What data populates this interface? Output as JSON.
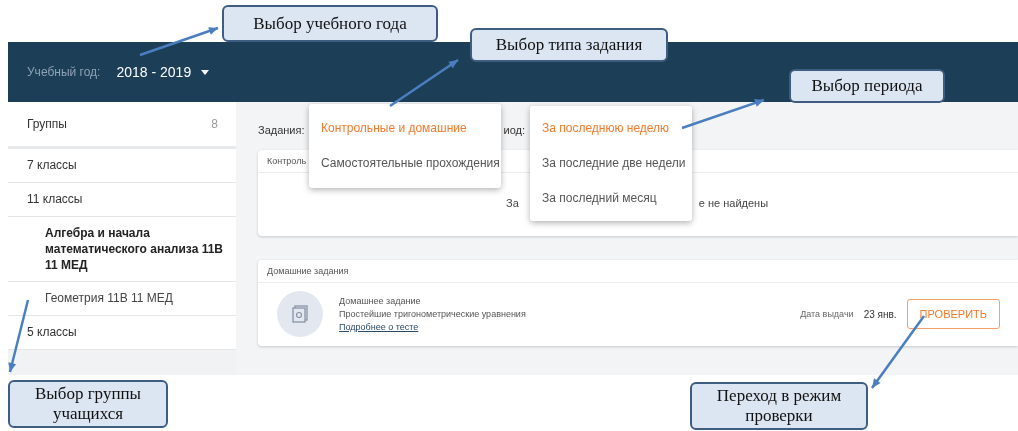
{
  "header": {
    "year_label": "Учебный год:",
    "year_value": "2018 - 2019"
  },
  "sidebar": {
    "title": "Группы",
    "count": "8",
    "groups": [
      {
        "label": "7 классы",
        "selected": false
      },
      {
        "label": "11 классы",
        "selected": false,
        "children": [
          {
            "label": "Алгебра и начала математического анализа 11В 11 МЕД",
            "selected": true
          },
          {
            "label": "Геометрия 11В 11 МЕД",
            "selected": false
          }
        ]
      },
      {
        "label": "5 классы",
        "selected": false
      }
    ]
  },
  "filters": {
    "task_label": "Задания:",
    "period_label_fragment": "иод:"
  },
  "cards": [
    {
      "kind": "empty",
      "title": "Контроль",
      "message_parts": [
        "За",
        "е не найдены"
      ]
    },
    {
      "kind": "tasks",
      "title": "Домашние задания",
      "tasks": [
        {
          "type": "Домашнее задание",
          "name": "Простейшие тригонометрические уравнения",
          "link": "Подробнее о тесте",
          "date_label": "Дата выдачи",
          "date": "23 янв.",
          "action": "ПРОВЕРИТЬ"
        }
      ]
    }
  ],
  "task_menu": {
    "options": [
      {
        "label": "Контрольные и домашние",
        "selected": true
      },
      {
        "label": "Самостоятельные прохождения",
        "selected": false
      }
    ]
  },
  "period_menu": {
    "options": [
      {
        "label": "За последнюю неделю",
        "selected": true
      },
      {
        "label": "За последние две недели",
        "selected": false
      },
      {
        "label": "За последний месяц",
        "selected": false
      }
    ]
  },
  "callouts": [
    {
      "text": "Выбор учебного года"
    },
    {
      "text": "Выбор типа задания"
    },
    {
      "text": "Выбор периода"
    },
    {
      "text": "Выбор группы учащихся"
    },
    {
      "text": "Переход в режим проверки"
    }
  ]
}
